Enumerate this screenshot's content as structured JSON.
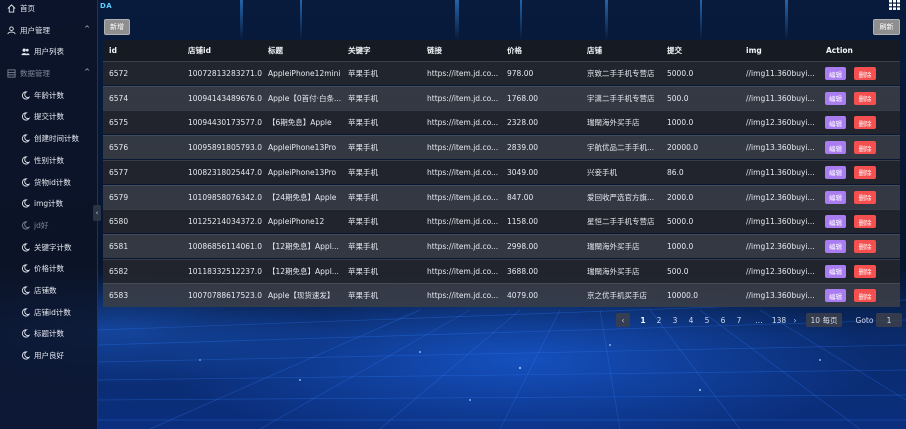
{
  "brand": "DA",
  "sidebar": {
    "items": [
      {
        "label": "首页",
        "icon": "home-icon"
      },
      {
        "label": "用户管理",
        "icon": "user-icon",
        "arrow": "^"
      },
      {
        "label": "用户列表",
        "icon": "users-icon"
      },
      {
        "label": "数据管理",
        "icon": "data-icon",
        "arrow": "^"
      },
      {
        "label": "年龄计数",
        "icon": "moon-icon"
      },
      {
        "label": "提交计数",
        "icon": "moon-icon"
      },
      {
        "label": "创建时间计数",
        "icon": "moon-icon"
      },
      {
        "label": "性别计数",
        "icon": "moon-icon"
      },
      {
        "label": "货物id计数",
        "icon": "moon-icon"
      },
      {
        "label": "img计数",
        "icon": "moon-icon"
      },
      {
        "label": "jd好",
        "icon": "moon-icon"
      },
      {
        "label": "关键字计数",
        "icon": "moon-icon"
      },
      {
        "label": "价格计数",
        "icon": "moon-icon"
      },
      {
        "label": "店铺数",
        "icon": "moon-icon"
      },
      {
        "label": "店铺id计数",
        "icon": "moon-icon"
      },
      {
        "label": "标题计数",
        "icon": "moon-icon"
      },
      {
        "label": "用户良好",
        "icon": "moon-icon"
      }
    ],
    "collapse": "‹"
  },
  "toolbar": {
    "add_label": "新增",
    "refresh_label": "刷新"
  },
  "table": {
    "columns": [
      "id",
      "店铺id",
      "标题",
      "关键字",
      "链接",
      "价格",
      "店铺",
      "提交",
      "img",
      "Action"
    ],
    "rows": [
      [
        "6572",
        "10072813283271.0",
        "AppleiPhone12mini",
        "苹果手机",
        "https://item.jd.co...",
        "978.00",
        "京致二手手机专营店",
        "5000.0",
        "//img11.360buyi..."
      ],
      [
        "6574",
        "10094143489676.0",
        "Apple【0首付·白条...",
        "苹果手机",
        "https://item.jd.co...",
        "1768.00",
        "宇潇二手手机专营店",
        "500.0",
        "//img11.360buyi..."
      ],
      [
        "6575",
        "10094430173577.0",
        "【6期免息】Apple",
        "苹果手机",
        "https://item.jd.co...",
        "2328.00",
        "瑞閛海外买手店",
        "1000.0",
        "//img12.360buyi..."
      ],
      [
        "6576",
        "10095891805793.0",
        "AppleiPhone13Pro",
        "苹果手机",
        "https://item.jd.co...",
        "2839.00",
        "宇航优品二手手机...",
        "20000.0",
        "//img13.360buyi..."
      ],
      [
        "6577",
        "10082318025447.0",
        "AppleiPhone13Pro",
        "苹果手机",
        "https://item.jd.co...",
        "3049.00",
        "兴妾手机",
        "86.0",
        "//img11.360buyi..."
      ],
      [
        "6579",
        "10109858076342.0",
        "【24期免息】Apple",
        "苹果手机",
        "https://item.jd.co...",
        "847.00",
        "爱回收严选官方旗...",
        "2000.0",
        "//img12.360buyi..."
      ],
      [
        "6580",
        "10125214034372.0",
        "AppleiPhone12",
        "苹果手机",
        "https://item.jd.co...",
        "1158.00",
        "星恒二手手机专营店",
        "5000.0",
        "//img11.360buyi..."
      ],
      [
        "6581",
        "10086856114061.0",
        "【12期免息】Appl...",
        "苹果手机",
        "https://item.jd.co...",
        "2998.00",
        "瑞閛海外买手店",
        "1000.0",
        "//img12.360buyi..."
      ],
      [
        "6582",
        "10118332512237.0",
        "【12期免息】Appl...",
        "苹果手机",
        "https://item.jd.co...",
        "3688.00",
        "瑞閛海外买手店",
        "500.0",
        "//img12.360buyi..."
      ],
      [
        "6583",
        "10070788617523.0",
        "Apple【现货速发】",
        "苹果手机",
        "https://item.jd.co...",
        "4079.00",
        "京之优手机买手店",
        "10000.0",
        "//img13.360buyi..."
      ]
    ],
    "edit_label": "编辑",
    "delete_label": "删除"
  },
  "pagination": {
    "prev": "‹",
    "pages": [
      "1",
      "2",
      "3",
      "4",
      "5",
      "6",
      "7"
    ],
    "active_page": "1",
    "ellipsis": "...",
    "last_page": "138",
    "next": "›",
    "page_size": "10 每页",
    "goto_label": "Goto",
    "goto_value": "1"
  },
  "colors": {
    "edit": "#a97cf0",
    "delete": "#f54f4f"
  }
}
